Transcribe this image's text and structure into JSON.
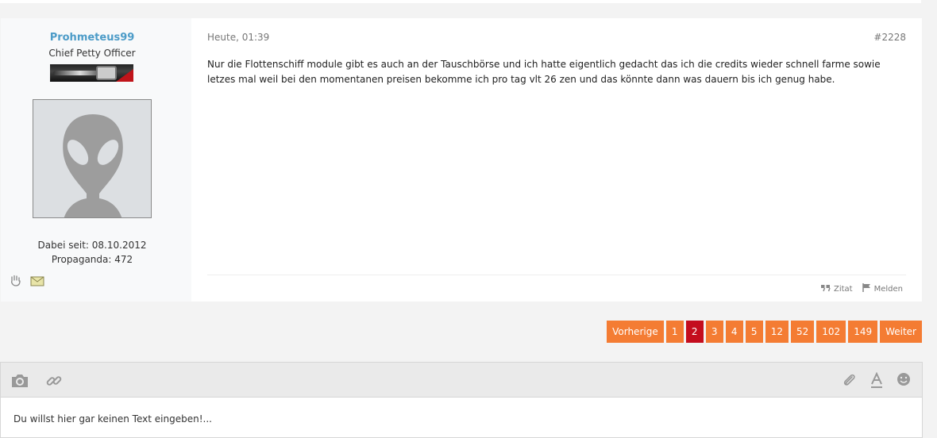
{
  "post": {
    "username": "Prohmeteus99",
    "rank": "Chief Petty Officer",
    "joined": "Dabei seit: 08.10.2012",
    "propaganda": "Propaganda: 472",
    "date": "Heute, 01:39",
    "number": "#2228",
    "body": "Nur die Flottenschiff module gibt es auch an der Tauschbörse und ich hatte eigentlich gedacht das ich die credits wieder schnell farme sowie letzes mal weil bei den momentanen preisen bekomme ich pro tag vlt 26 zen und das könnte dann was dauern bis ich genug habe.",
    "actions": {
      "quote": "Zitat",
      "report": "Melden"
    }
  },
  "pagination": {
    "prev": "Vorherige",
    "pages": [
      "1",
      "2",
      "3",
      "4",
      "5",
      "12",
      "52",
      "102",
      "149"
    ],
    "current": "2",
    "next": "Weiter"
  },
  "editor": {
    "placeholder": "Du willst hier gar keinen Text eingeben!..."
  },
  "colors": {
    "accent": "#f47c33",
    "active_page": "#c40d1e",
    "username": "#4d9cc8"
  }
}
